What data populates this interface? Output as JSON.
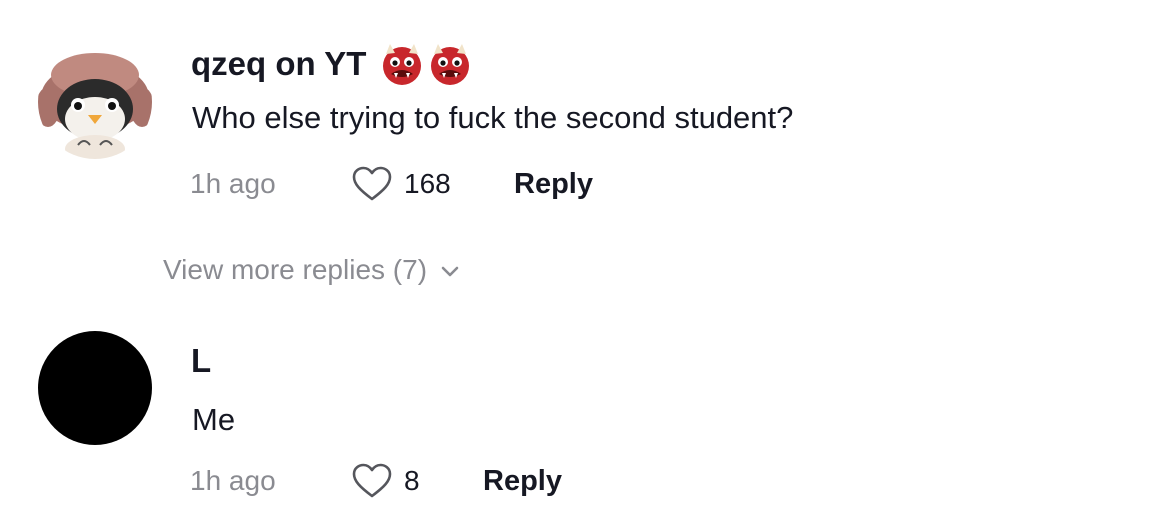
{
  "comments": [
    {
      "username": "qzeq on YT",
      "username_emojis": [
        "ogre-emoji",
        "ogre-emoji"
      ],
      "text": "Who else trying to fuck the second student?",
      "time": "1h ago",
      "likes": "168",
      "reply_label": "Reply",
      "avatar": "penguin-with-hat"
    },
    {
      "username": "L",
      "text": "Me",
      "time": "1h ago",
      "likes": "8",
      "reply_label": "Reply",
      "avatar": "black-circle"
    }
  ],
  "view_more": {
    "label": "View more replies (7)",
    "icon": "chevron-down-icon"
  },
  "colors": {
    "primary_text": "#161823",
    "secondary_text": "#8a8b91",
    "ogre_red": "#c8272c"
  }
}
